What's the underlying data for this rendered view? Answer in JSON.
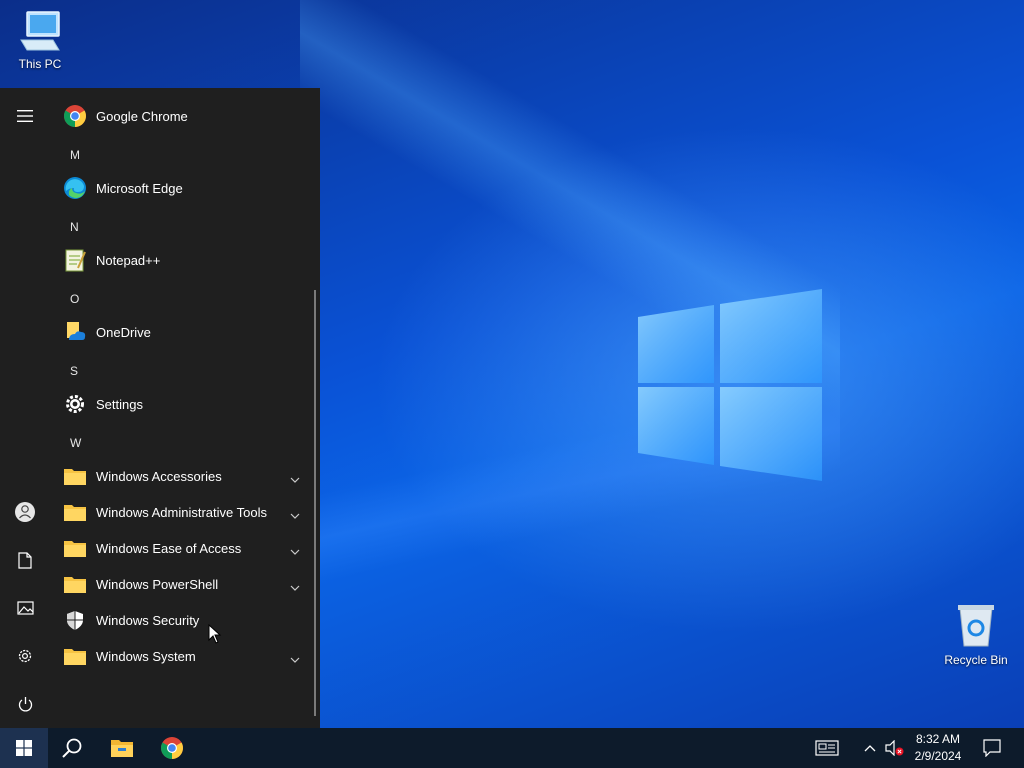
{
  "desktop": {
    "icons": [
      {
        "label": "This PC"
      },
      {
        "label": "Recycle Bin"
      }
    ]
  },
  "start_menu": {
    "rail": [
      "hamburger-menu",
      "user-account",
      "documents",
      "pictures",
      "settings",
      "power"
    ],
    "entries": [
      {
        "type": "app",
        "name": "Google Chrome",
        "icon": "chrome-icon"
      },
      {
        "type": "letter",
        "name": "M"
      },
      {
        "type": "app",
        "name": "Microsoft Edge",
        "icon": "edge-icon"
      },
      {
        "type": "letter",
        "name": "N"
      },
      {
        "type": "app",
        "name": "Notepad++",
        "icon": "notepadpp-icon"
      },
      {
        "type": "letter",
        "name": "O"
      },
      {
        "type": "app",
        "name": "OneDrive",
        "icon": "onedrive-icon"
      },
      {
        "type": "letter",
        "name": "S"
      },
      {
        "type": "app",
        "name": "Settings",
        "icon": "gear-icon"
      },
      {
        "type": "letter",
        "name": "W"
      },
      {
        "type": "folder",
        "name": "Windows Accessories"
      },
      {
        "type": "folder",
        "name": "Windows Administrative Tools"
      },
      {
        "type": "folder",
        "name": "Windows Ease of Access"
      },
      {
        "type": "folder",
        "name": "Windows PowerShell"
      },
      {
        "type": "app",
        "name": "Windows Security",
        "icon": "shield-icon"
      },
      {
        "type": "folder",
        "name": "Windows System"
      }
    ]
  },
  "taskbar": {
    "pinned": [
      "start-button",
      "search-button",
      "file-explorer",
      "google-chrome"
    ],
    "tray": [
      "news-and-interests",
      "show-hidden-icons",
      "volume-muted",
      "action-center"
    ],
    "time": "8:32 AM",
    "date": "2/9/2024"
  },
  "colors": {
    "menu_bg": "#1f1f1f",
    "taskbar_bg": "#0d1b2b",
    "accent": "#0a52d6"
  }
}
